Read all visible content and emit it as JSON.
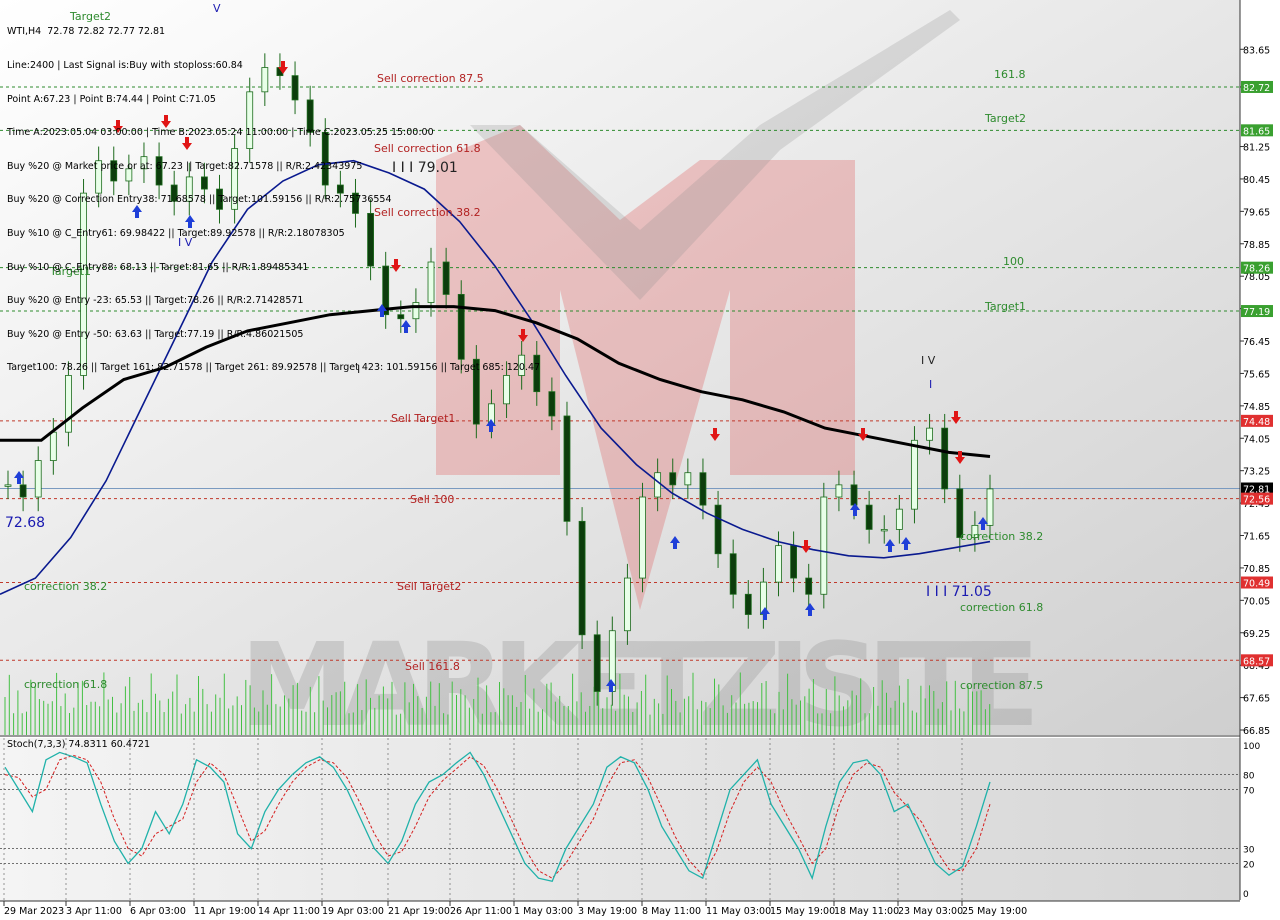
{
  "header": {
    "lines": [
      "WTI,H4  72.78 72.82 72.77 72.81",
      "Line:2400 | Last Signal is:Buy with stoploss:60.84",
      "Point A:67.23 | Point B:74.44 | Point C:71.05",
      "Time A:2023.05.04 03:00:00 | Time B:2023.05.24 11:00:00 | Time C:2023.05.25 15:00:00",
      "Buy %20 @ Market price or at: 67.23 || Target:82.71578 || R/R:2.42343975",
      "Buy %20 @ Correction Entry38: 71.68578 || Target:101.59156 || R/R:2.75736554",
      "Buy %10 @ C_Entry61: 69.98422 || Target:89.92578 || R/R:2.18078305",
      "Buy %10 @ C_Entry88: 68.13 || Target:81.65 || R/R:1.89485341",
      "Buy %20 @ Entry -23: 65.53 || Target:78.26 || R/R:2.71428571",
      "Buy %20 @ Entry -50: 63.63 || Target:77.19 || R/R:4.86021505",
      "Target100: 78.26 || Target 161: 82.71578 || Target 261: 89.92578 || Target 423: 101.59156 || Target 685: 120.47"
    ]
  },
  "stoch_label": "Stoch(7,3,3) 74.8311 60.4721",
  "colors": {
    "green_line": "#2e8b2e",
    "red_line": "#c0392b",
    "blue_ma": "#0a1a8f",
    "black_ma": "#000000",
    "stoch_main": "#20b2aa",
    "stoch_signal": "#d62020",
    "badge_red": "#e03030",
    "badge_green": "#3aa030",
    "price_badge": "#000000"
  },
  "chart_data": {
    "type": "candlestick",
    "instrument": "WTI",
    "timeframe": "H4",
    "last_price": 72.81,
    "ylim": [
      66.85,
      84.2
    ],
    "y_ticks": [
      83.65,
      82.72,
      81.25,
      80.45,
      79.65,
      78.85,
      78.05,
      77.25,
      76.45,
      75.65,
      74.85,
      74.05,
      73.25,
      72.45,
      71.65,
      70.85,
      70.05,
      69.25,
      68.45,
      67.65,
      66.85
    ],
    "x_ticks": [
      "29 Mar 2023",
      "3 Apr 11:00",
      "6 Apr 03:00",
      "11 Apr 19:00",
      "14 Apr 11:00",
      "19 Apr 03:00",
      "21 Apr 19:00",
      "26 Apr 11:00",
      "1 May 03:00",
      "3 May 19:00",
      "8 May 11:00",
      "11 May 03:00",
      "15 May 19:00",
      "18 May 11:00",
      "23 May 03:00",
      "25 May 19:00"
    ],
    "close_series": [
      72.9,
      72.6,
      73.5,
      74.2,
      75.6,
      80.1,
      80.9,
      80.4,
      80.7,
      81.0,
      80.3,
      79.9,
      80.5,
      80.2,
      79.7,
      81.2,
      82.6,
      83.2,
      83.0,
      82.4,
      81.6,
      80.3,
      80.1,
      79.6,
      78.3,
      77.1,
      77.0,
      77.4,
      78.4,
      77.6,
      76.0,
      74.4,
      74.9,
      75.6,
      76.1,
      75.2,
      74.6,
      72.0,
      69.2,
      67.8,
      69.3,
      70.6,
      72.6,
      73.2,
      72.9,
      73.2,
      72.4,
      71.2,
      70.2,
      69.7,
      70.5,
      71.4,
      70.6,
      70.2,
      72.6,
      72.9,
      72.4,
      71.8,
      71.8,
      72.3,
      74.0,
      74.3,
      72.8,
      71.6,
      71.9,
      72.8
    ],
    "series": [
      {
        "name": "MA blue",
        "values": [
          70.2,
          70.6,
          71.6,
          73.0,
          74.8,
          76.6,
          78.4,
          79.7,
          80.4,
          80.8,
          80.9,
          80.6,
          80.2,
          79.4,
          78.3,
          77.0,
          75.6,
          74.3,
          73.4,
          72.7,
          72.2,
          71.8,
          71.5,
          71.3,
          71.15,
          71.1,
          71.2,
          71.35,
          71.5
        ]
      },
      {
        "name": "MA black",
        "values": [
          74.0,
          74.0,
          74.8,
          75.5,
          75.8,
          76.3,
          76.7,
          76.9,
          77.1,
          77.2,
          77.3,
          77.3,
          77.2,
          76.9,
          76.5,
          75.9,
          75.5,
          75.2,
          75.0,
          74.7,
          74.3,
          74.1,
          73.9,
          73.7,
          73.6
        ]
      }
    ],
    "horizontal_levels": [
      {
        "price": 82.72,
        "label": "161.8",
        "style": "green"
      },
      {
        "price": 81.65,
        "label": "Target2",
        "style": "green"
      },
      {
        "price": 78.26,
        "label": "100",
        "style": "green"
      },
      {
        "price": 77.19,
        "label": "Target1",
        "style": "green"
      },
      {
        "price": 74.48,
        "label": "Sell Target1",
        "style": "red"
      },
      {
        "price": 72.56,
        "label": "Sell 100",
        "style": "red"
      },
      {
        "price": 70.49,
        "label": "Sell Target2",
        "style": "red"
      },
      {
        "price": 68.57,
        "label": "Sell 161.8",
        "style": "red"
      }
    ],
    "price_badges": [
      {
        "price": 82.72,
        "text": "82.72",
        "color": "green"
      },
      {
        "price": 81.65,
        "text": "81.65",
        "color": "green"
      },
      {
        "price": 78.26,
        "text": "78.26",
        "color": "green"
      },
      {
        "price": 77.19,
        "text": "77.19",
        "color": "green"
      },
      {
        "price": 74.48,
        "text": "74.48",
        "color": "red"
      },
      {
        "price": 72.81,
        "text": "72.81",
        "color": "black"
      },
      {
        "price": 72.56,
        "text": "72.56",
        "color": "red"
      },
      {
        "price": 70.49,
        "text": "70.49",
        "color": "red"
      },
      {
        "price": 68.57,
        "text": "68.57",
        "color": "red"
      }
    ],
    "annotations": [
      {
        "text": "Target2",
        "x": 70,
        "y": 20,
        "color": "green"
      },
      {
        "text": "Sell correction 87.5",
        "x": 377,
        "y": 82,
        "color": "red"
      },
      {
        "text": "Sell correction 61.8",
        "x": 374,
        "y": 152,
        "color": "red"
      },
      {
        "text": "I I I 79.01",
        "x": 392,
        "y": 172,
        "color": "black"
      },
      {
        "text": "Sell correction 38.2",
        "x": 374,
        "y": 216,
        "color": "red"
      },
      {
        "text": "I V",
        "x": 178,
        "y": 246,
        "color": "blue"
      },
      {
        "text": "Target1",
        "x": 50,
        "y": 275,
        "color": "green"
      },
      {
        "text": "I",
        "x": 357,
        "y": 373,
        "color": "black"
      },
      {
        "text": "Sell Target1",
        "x": 391,
        "y": 422,
        "color": "red"
      },
      {
        "text": "Sell 100",
        "x": 410,
        "y": 503,
        "color": "red"
      },
      {
        "text": "72.68",
        "x": 5,
        "y": 527,
        "color": "blue"
      },
      {
        "text": "Sell Target2",
        "x": 397,
        "y": 590,
        "color": "red"
      },
      {
        "text": "correction 38.2",
        "x": 24,
        "y": 590,
        "color": "green"
      },
      {
        "text": "Sell 161.8",
        "x": 405,
        "y": 670,
        "color": "red"
      },
      {
        "text": "correction 61.8",
        "x": 24,
        "y": 688,
        "color": "green"
      },
      {
        "text": "I V",
        "x": 921,
        "y": 364,
        "color": "black"
      },
      {
        "text": "I",
        "x": 929,
        "y": 388,
        "color": "blue"
      },
      {
        "text": "correction 38.2",
        "x": 960,
        "y": 540,
        "color": "green"
      },
      {
        "text": "I I I 71.05",
        "x": 926,
        "y": 596,
        "color": "blue"
      },
      {
        "text": "correction 61.8",
        "x": 960,
        "y": 611,
        "color": "green"
      },
      {
        "text": "correction 87.5",
        "x": 960,
        "y": 689,
        "color": "green"
      },
      {
        "text": "161.8",
        "x": 994,
        "y": 78,
        "color": "green"
      },
      {
        "text": "Target2",
        "x": 985,
        "y": 122,
        "color": "green"
      },
      {
        "text": "100",
        "x": 1003,
        "y": 265,
        "color": "green"
      },
      {
        "text": "Target1",
        "x": 985,
        "y": 310,
        "color": "green"
      },
      {
        "text": "V",
        "x": 213,
        "y": 12,
        "color": "blue"
      }
    ],
    "signal_arrows": {
      "buy": [
        [
          137,
          212
        ],
        [
          190,
          222
        ],
        [
          382,
          311
        ],
        [
          406,
          327
        ],
        [
          491,
          426
        ],
        [
          675,
          543
        ],
        [
          611,
          686
        ],
        [
          765,
          614
        ],
        [
          810,
          610
        ],
        [
          855,
          510
        ],
        [
          890,
          546
        ],
        [
          906,
          544
        ],
        [
          983,
          524
        ],
        [
          19,
          478
        ]
      ],
      "sell": [
        [
          118,
          126
        ],
        [
          187,
          143
        ],
        [
          166,
          121
        ],
        [
          283,
          67
        ],
        [
          396,
          265
        ],
        [
          523,
          335
        ],
        [
          715,
          434
        ],
        [
          863,
          434
        ],
        [
          956,
          417
        ],
        [
          960,
          457
        ],
        [
          806,
          546
        ]
      ]
    },
    "stochastic": {
      "label": "Stoch(7,3,3)",
      "main": 74.8311,
      "signal": 60.4721,
      "levels": [
        100,
        80,
        70,
        30,
        20,
        0
      ],
      "ylim": [
        0,
        100
      ],
      "main_values": [
        85,
        70,
        55,
        90,
        95,
        92,
        88,
        60,
        35,
        20,
        30,
        55,
        40,
        60,
        90,
        85,
        75,
        40,
        30,
        55,
        70,
        80,
        88,
        92,
        85,
        70,
        50,
        30,
        20,
        35,
        60,
        75,
        80,
        88,
        95,
        80,
        60,
        40,
        20,
        10,
        8,
        30,
        45,
        60,
        85,
        92,
        88,
        70,
        45,
        30,
        15,
        10,
        40,
        70,
        80,
        90,
        60,
        45,
        30,
        10,
        45,
        75,
        88,
        90,
        80,
        55,
        60,
        40,
        20,
        12,
        18,
        45,
        75
      ],
      "signal_values": [
        80,
        78,
        65,
        70,
        90,
        93,
        90,
        75,
        50,
        30,
        25,
        40,
        45,
        50,
        75,
        88,
        80,
        58,
        35,
        42,
        60,
        75,
        85,
        90,
        88,
        78,
        60,
        40,
        25,
        28,
        45,
        65,
        76,
        84,
        92,
        86,
        70,
        50,
        30,
        15,
        10,
        20,
        35,
        50,
        72,
        88,
        90,
        78,
        58,
        38,
        22,
        12,
        28,
        55,
        75,
        85,
        75,
        55,
        38,
        20,
        30,
        60,
        80,
        88,
        85,
        68,
        58,
        48,
        30,
        16,
        15,
        30,
        60
      ]
    }
  },
  "watermark": "MARKETZISITE"
}
